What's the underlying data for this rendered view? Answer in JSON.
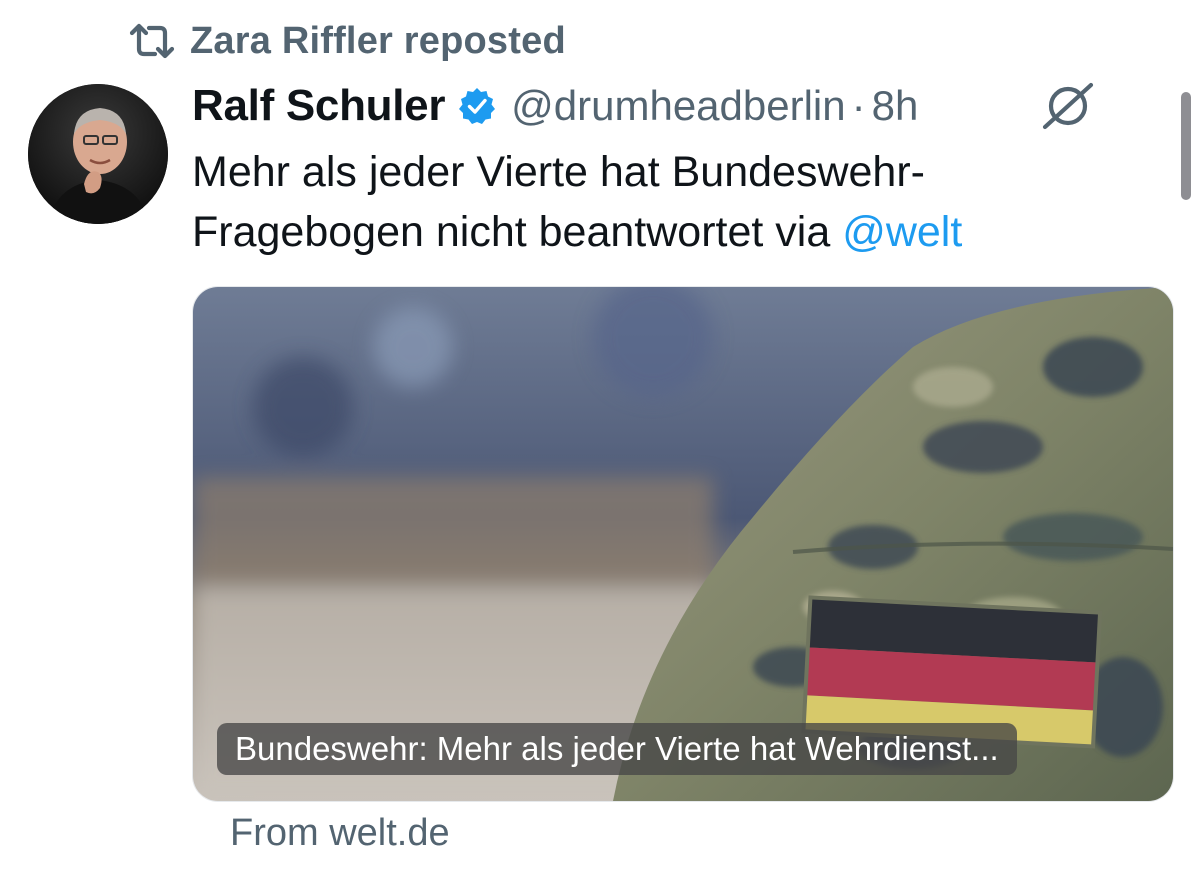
{
  "repost": {
    "text": "Zara Riffler reposted",
    "icon": "repost-icon"
  },
  "tweet": {
    "author": {
      "name": "Ralf Schuler",
      "handle": "@drumheadberlin",
      "verified": true
    },
    "separator": "·",
    "time": "8h",
    "text_line1": "Mehr als jeder Vierte hat Bundeswehr-",
    "text_line2_prefix": "Fragebogen nicht beantwortet via ",
    "mention": "@welt"
  },
  "link_card": {
    "title": "Bundeswehr: Mehr als jeder Vierte hat Wehrdienst...",
    "source": "From welt.de"
  },
  "colors": {
    "muted": "#536471",
    "link": "#1d9bf0",
    "verified": "#1d9bf0",
    "text": "#0f1419"
  }
}
